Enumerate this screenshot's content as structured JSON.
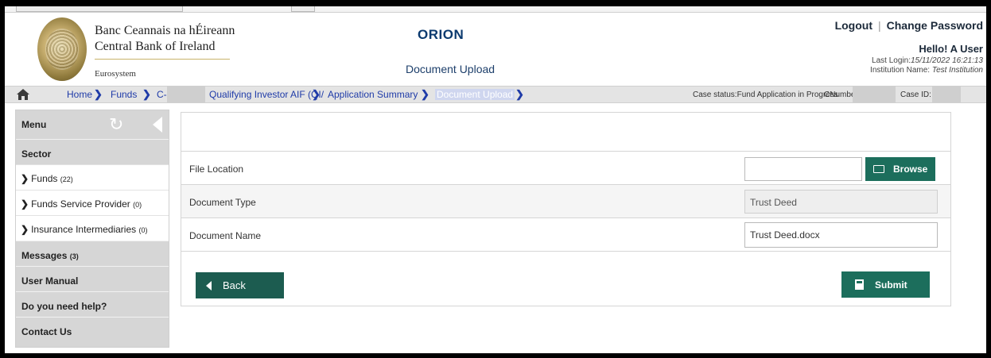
{
  "header": {
    "bank_line1": "Banc Ceannais na hÉireann",
    "bank_line2": "Central Bank of Ireland",
    "bank_system": "Eurosystem",
    "app_title": "ORION",
    "page_subtitle": "Document Upload",
    "logout_label": "Logout",
    "separator": "|",
    "change_password_label": "Change Password",
    "greeting": "Hello! A User",
    "last_login_label": "Last Login:",
    "last_login_value": "15/11/2022 16:21:13",
    "institution_label": "Institution Name:",
    "institution_value": "Test Institution"
  },
  "breadcrumb": {
    "items": [
      "Home",
      "Funds",
      "C-",
      "Qualifying Investor AIF (QI/",
      "Application Summary",
      "Document Upload"
    ],
    "arrow": "❯",
    "case_status": "Case status:Fund Application in Progress",
    "cnumber_label": "CNumber",
    "case_id_label": "Case ID:"
  },
  "sidebar": {
    "menu_label": "Menu",
    "sector_label": "Sector",
    "items": [
      {
        "label": "Funds",
        "count": "(22)"
      },
      {
        "label": "Funds Service Provider",
        "count": "(0)"
      },
      {
        "label": "Insurance Intermediaries",
        "count": "(0)"
      }
    ],
    "messages_label": "Messages",
    "messages_count": "(3)",
    "user_manual_label": "User Manual",
    "help_label": "Do you need help?",
    "contact_label": "Contact Us",
    "chevron": "❯"
  },
  "form": {
    "file_location_label": "File Location",
    "file_location_value": "",
    "browse_label": "Browse",
    "document_type_label": "Document Type",
    "document_type_value": "Trust Deed",
    "document_name_label": "Document Name",
    "document_name_value": "Trust Deed.docx",
    "back_label": "Back",
    "submit_label": "Submit"
  },
  "colors": {
    "button_green": "#1c6e5c",
    "link_blue": "#1f3ba8",
    "title_navy": "#0b3a6f"
  }
}
